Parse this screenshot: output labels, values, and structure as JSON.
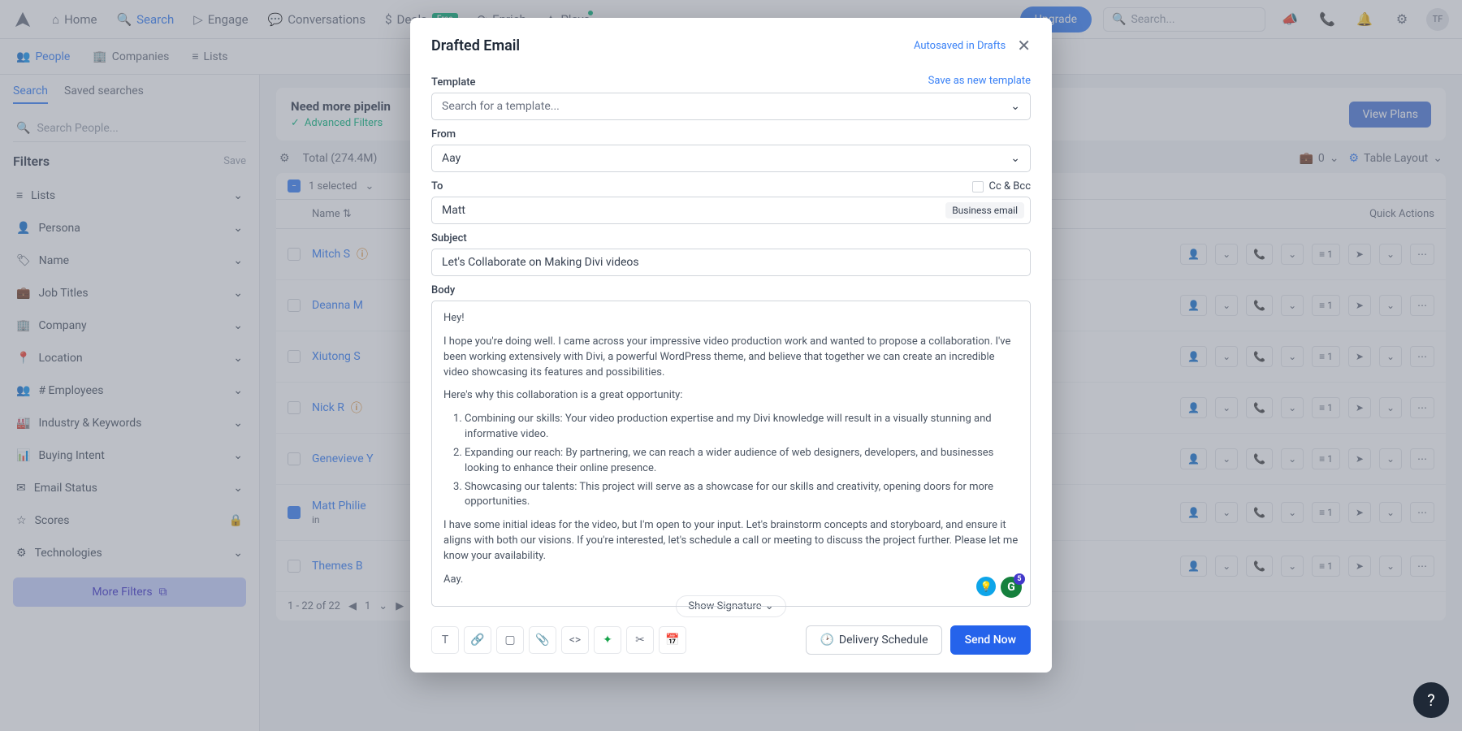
{
  "topnav": {
    "items": [
      "Home",
      "Search",
      "Engage",
      "Conversations",
      "Deals",
      "Enrich",
      "Plays"
    ],
    "free_badge": "Free",
    "upgrade": "Upgrade",
    "search_placeholder": "Search...",
    "avatar": "TF"
  },
  "subnav": {
    "people": "People",
    "companies": "Companies",
    "lists": "Lists"
  },
  "sidebar": {
    "tabs": {
      "search": "Search",
      "saved": "Saved searches"
    },
    "search_placeholder": "Search People...",
    "filters_title": "Filters",
    "save": "Save",
    "items": [
      "Lists",
      "Persona",
      "Name",
      "Job Titles",
      "Company",
      "Location",
      "# Employees",
      "Industry & Keywords",
      "Buying Intent",
      "Email Status",
      "Scores",
      "Technologies"
    ],
    "more": "More Filters"
  },
  "banner": {
    "title": "Need more pipelin",
    "sub": "Advanced Filters",
    "cta": "View Plans"
  },
  "toolbar": {
    "total": "Total (274.4M)",
    "brief_zero": "0",
    "layout": "Table Layout"
  },
  "table": {
    "selected": "1 selected",
    "name_col": "Name",
    "qa_col": "Quick Actions",
    "rows": [
      {
        "name": "Mitch S",
        "sub": "",
        "info": true,
        "orange": false
      },
      {
        "name": "Deanna M",
        "sub": "",
        "info": false,
        "orange": false
      },
      {
        "name": "Xiutong S",
        "sub": "",
        "info": false,
        "orange": true
      },
      {
        "name": "Nick R",
        "sub": "",
        "info": true,
        "orange": false
      },
      {
        "name": "Genevieve Y",
        "sub": "",
        "info": false,
        "orange": true
      },
      {
        "name": "Matt Philie",
        "sub": "in",
        "info": false,
        "orange": false,
        "checked": true
      },
      {
        "name": "Themes B",
        "sub": "",
        "info": false,
        "orange": true
      }
    ],
    "pager": "1 - 22 of 22",
    "page": "1"
  },
  "modal": {
    "title": "Drafted Email",
    "autosaved": "Autosaved in Drafts",
    "template_label": "Template",
    "save_template": "Save as new template",
    "template_placeholder": "Search for a template...",
    "from_label": "From",
    "from_value": "Aay",
    "to_label": "To",
    "ccbcc": "Cc & Bcc",
    "to_value": "Matt",
    "biz_tag": "Business email",
    "subject_label": "Subject",
    "subject_value": "Let's Collaborate on Making Divi videos",
    "body_label": "Body",
    "body": {
      "p1": "Hey!",
      "p2": "I hope you're doing well. I came across your impressive video production work and wanted to propose a collaboration. I've been working extensively with Divi, a powerful WordPress theme, and believe that together we can create an incredible video showcasing its features and possibilities.",
      "p3": "Here's why this collaboration is a great opportunity:",
      "li1": "Combining our skills: Your video production expertise and my Divi knowledge will result in a visually stunning and informative video.",
      "li2": "Expanding our reach: By partnering, we can reach a wider audience of web designers, developers, and businesses looking to enhance their online presence.",
      "li3": "Showcasing our talents: This project will serve as a showcase for our skills and creativity, opening doors for more opportunities.",
      "p4": "I have some initial ideas for the video, but I'm open to your input. Let's brainstorm concepts and storyboard, and ensure it aligns with both our visions. If you're interested, let's schedule a call or meeting to discuss the project further. Please let me know your availability.",
      "p5": "Aay."
    },
    "show_sig": "Show Signature",
    "deliv": "Delivery Schedule",
    "send": "Send Now",
    "gram_badge": "5"
  }
}
